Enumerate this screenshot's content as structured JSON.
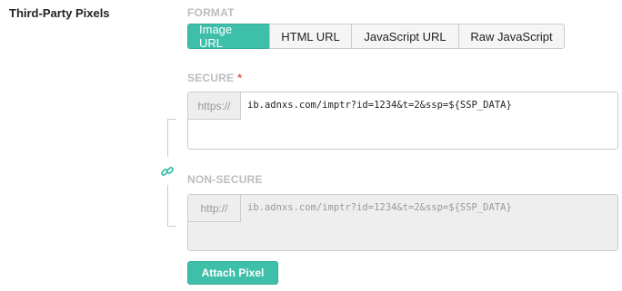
{
  "section": {
    "label": "Third-Party Pixels"
  },
  "format": {
    "label": "FORMAT",
    "options": [
      {
        "label": "Image URL",
        "active": true
      },
      {
        "label": "HTML URL",
        "active": false
      },
      {
        "label": "JavaScript URL",
        "active": false
      },
      {
        "label": "Raw JavaScript",
        "active": false
      }
    ]
  },
  "secure": {
    "label": "SECURE",
    "required_marker": "*",
    "prefix": "https://",
    "value": "ib.adnxs.com/imptr?id=1234&t=2&ssp=${SSP_DATA}"
  },
  "non_secure": {
    "label": "NON-SECURE",
    "prefix": "http://",
    "value": "ib.adnxs.com/imptr?id=1234&t=2&ssp=${SSP_DATA}"
  },
  "link_icon": "link-icon",
  "attach_button": {
    "label": "Attach Pixel"
  },
  "colors": {
    "accent": "#3dbfaa",
    "required": "#d9534f",
    "muted": "#bcbcbc"
  }
}
